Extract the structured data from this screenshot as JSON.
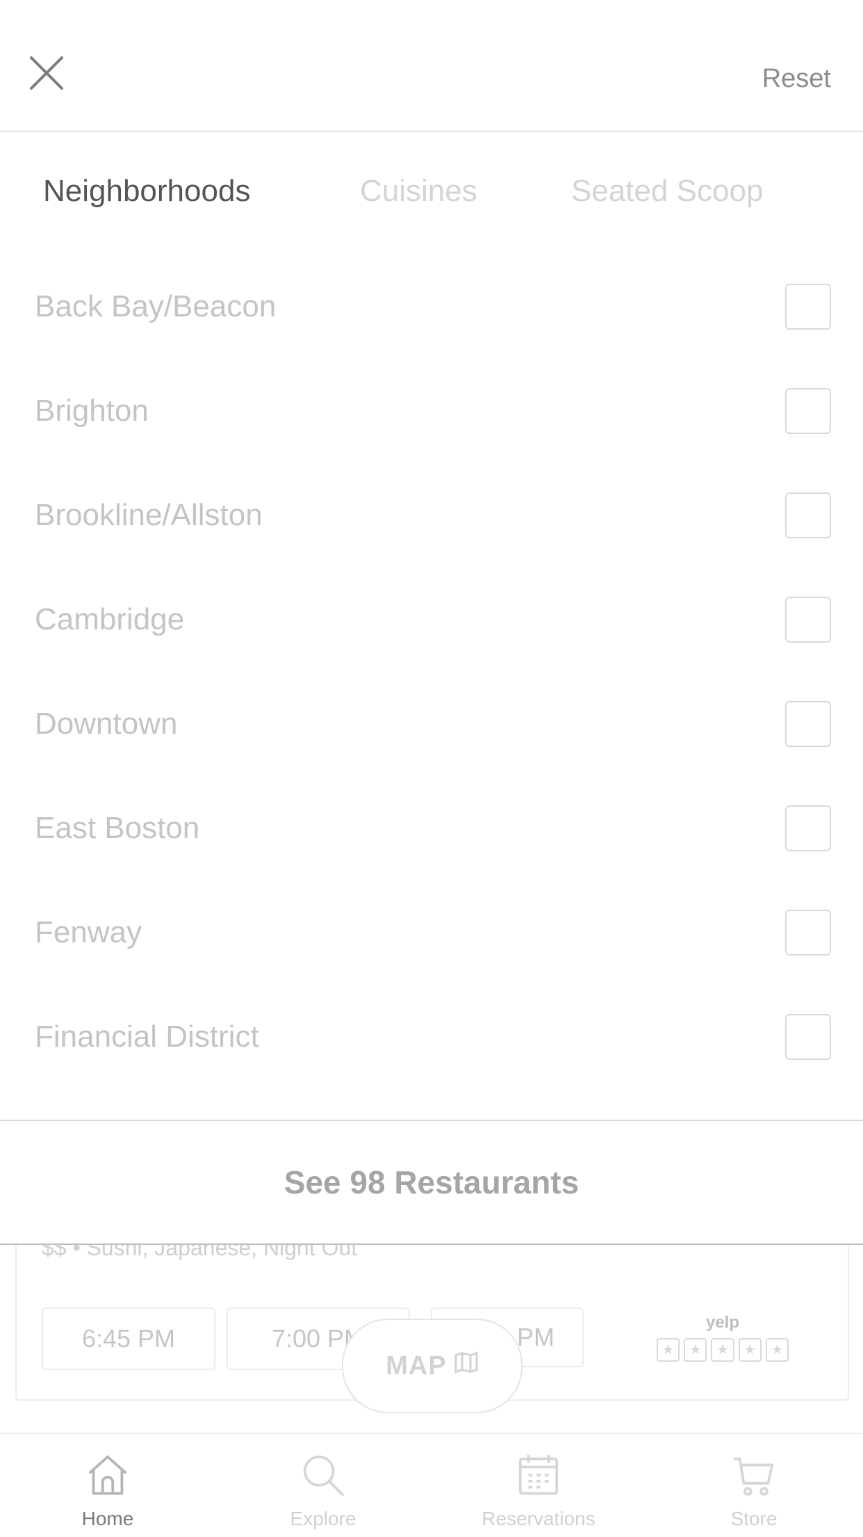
{
  "sheet": {
    "reset_label": "Reset",
    "tabs": [
      {
        "label": "Neighborhoods",
        "active": true
      },
      {
        "label": "Cuisines",
        "active": false
      },
      {
        "label": "Seated Scoop",
        "active": false
      }
    ],
    "neighborhoods": [
      {
        "label": "Back Bay/Beacon",
        "checked": false
      },
      {
        "label": "Brighton",
        "checked": false
      },
      {
        "label": "Brookline/Allston",
        "checked": false
      },
      {
        "label": "Cambridge",
        "checked": false
      },
      {
        "label": "Downtown",
        "checked": false
      },
      {
        "label": "East Boston",
        "checked": false
      },
      {
        "label": "Fenway",
        "checked": false
      },
      {
        "label": "Financial District",
        "checked": false
      }
    ],
    "cta_label": "See 98 Restaurants"
  },
  "background": {
    "restaurant_meta": "$$ • Sushi, Japanese, Night Out",
    "time_slots": [
      "6:45 PM",
      "7:00 PM",
      "PM"
    ],
    "yelp_logo": "yelp",
    "map_label": "MAP"
  },
  "tabbar": {
    "items": [
      {
        "label": "Home",
        "icon": "home-icon",
        "active": true
      },
      {
        "label": "Explore",
        "icon": "search-icon",
        "active": false
      },
      {
        "label": "Reservations",
        "icon": "calendar-icon",
        "active": false
      },
      {
        "label": "Store",
        "icon": "cart-icon",
        "active": false
      }
    ]
  },
  "colors": {
    "background": "#ffffff",
    "active_text": "#555555",
    "inactive_text": "#c4c4c4",
    "divider": "#e2e2e2"
  }
}
